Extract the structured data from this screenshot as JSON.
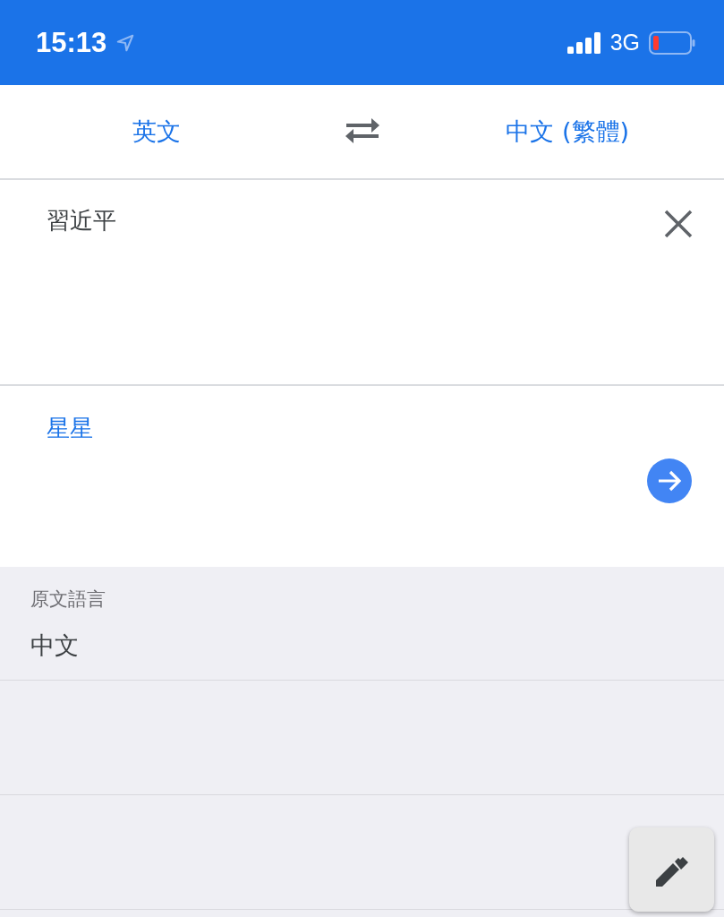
{
  "status_bar": {
    "time": "15:13",
    "network": "3G"
  },
  "language_bar": {
    "source": "英文",
    "target": "中文 (繁體)"
  },
  "input": {
    "value": "習近平"
  },
  "result": {
    "text": "星星"
  },
  "detected_language": {
    "label": "原文語言",
    "value": "中文"
  }
}
